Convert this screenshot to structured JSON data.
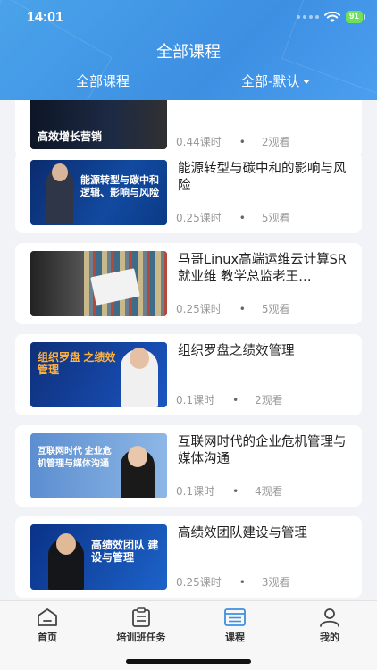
{
  "status_bar": {
    "time": "14:01",
    "battery": "91"
  },
  "header": {
    "title": "全部课程"
  },
  "filter": {
    "left_label": "全部课程",
    "right_label": "全部-默认"
  },
  "courses": [
    {
      "thumb_text": "高效增长营销",
      "title": "",
      "hours": "0.44课时",
      "views": "2观看"
    },
    {
      "thumb_text": "能源转型与碳中和 逻辑、影响与风险",
      "title": "能源转型与碳中和的影响与风险",
      "hours": "0.25课时",
      "views": "5观看"
    },
    {
      "thumb_text": "",
      "title": "马哥Linux高端运维云计算SR就业维 教学总监老王…",
      "hours": "0.25课时",
      "views": "5观看"
    },
    {
      "thumb_text": "组织罗盘 之绩效管理",
      "title": "组织罗盘之绩效管理",
      "hours": "0.1课时",
      "views": "2观看"
    },
    {
      "thumb_text": "互联网时代 企业危机管理与媒体沟通",
      "title": "互联网时代的企业危机管理与媒体沟通",
      "hours": "0.1课时",
      "views": "4观看"
    },
    {
      "thumb_text": "高绩效团队 建设与管理",
      "title": "高绩效团队建设与管理",
      "hours": "0.25课时",
      "views": "3观看"
    }
  ],
  "meta_separator": "•",
  "tabbar": {
    "tabs": [
      {
        "label": "首页",
        "icon": "home-icon"
      },
      {
        "label": "培训班任务",
        "icon": "task-icon"
      },
      {
        "label": "课程",
        "icon": "course-icon",
        "active": true
      },
      {
        "label": "我的",
        "icon": "profile-icon"
      }
    ]
  },
  "colors": {
    "header_blue": "#3d8fe2",
    "active_tab": "#3d8fe2"
  }
}
